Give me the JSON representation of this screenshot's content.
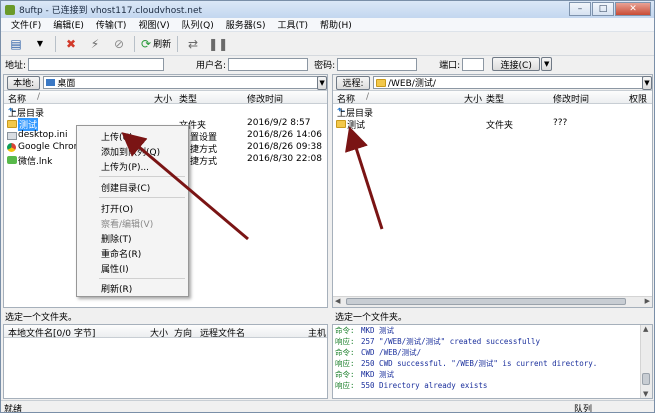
{
  "window": {
    "title": "8uftp - 已连接到 vhost117.cloudvhost.net",
    "minimize_icon": "minimize-icon",
    "maximize_icon": "maximize-icon",
    "close_icon": "close-icon"
  },
  "menu": [
    "文件(F)",
    "编辑(E)",
    "传输(T)",
    "视图(V)",
    "队列(Q)",
    "服务器(S)",
    "工具(T)",
    "帮助(H)"
  ],
  "toolbar": {
    "refresh_label": "刷新"
  },
  "address": {
    "address_label": "地址:",
    "user_label": "用户名:",
    "password_label": "密码:",
    "port_label": "端口:",
    "connect_label": "连接(C)"
  },
  "local": {
    "location_label": "本地:",
    "path": "桌面",
    "columns": [
      "名称",
      "大小",
      "类型",
      "修改时间"
    ],
    "up_label": "上层目录",
    "files": [
      {
        "name": "测试",
        "size": "",
        "type": "文件夹",
        "modified": "2016/9/2 8:57",
        "selected": true
      },
      {
        "name": "desktop.ini",
        "size": "",
        "type": "置设置",
        "modified": "2016/8/26 14:06"
      },
      {
        "name": "Google Chrom",
        "size": "",
        "type": "捷方式",
        "modified": "2016/8/26 09:38"
      },
      {
        "name": "微信.lnk",
        "size": "",
        "type": "捷方式",
        "modified": "2016/8/30 22:08"
      }
    ],
    "status": "选定一个文件夹。"
  },
  "remote": {
    "location_label": "远程:",
    "path": "/WEB/测试/",
    "columns": [
      "名称",
      "大小",
      "类型",
      "修改时间",
      "权限"
    ],
    "up_label": "上层目录",
    "files": [
      {
        "name": "测试",
        "size": "",
        "type": "文件夹",
        "modified": "???"
      }
    ],
    "status": "选定一个文件夹。"
  },
  "queue": {
    "columns": [
      "本地文件名[0/0 字节]",
      "大小",
      "方向",
      "远程文件名",
      "主机"
    ]
  },
  "log": [
    {
      "type": "命令:",
      "text": "MKD 测试"
    },
    {
      "type": "响应:",
      "text": "257 \"/WEB/测试/测试\" created successfully"
    },
    {
      "type": "命令:",
      "text": "CWD /WEB/测试/"
    },
    {
      "type": "响应:",
      "text": "250 CWD successful. \"/WEB/测试\" is current directory."
    },
    {
      "type": "命令:",
      "text": "MKD 测试"
    },
    {
      "type": "响应:",
      "text": "550 Directory already exists"
    }
  ],
  "context_menu": [
    {
      "label": "上传(U)",
      "enabled": true
    },
    {
      "label": "添加到队列(Q)",
      "enabled": true
    },
    {
      "label": "上传为(P)...",
      "enabled": true
    },
    {
      "label": "创建目录(C)",
      "enabled": true
    },
    {
      "label": "打开(O)",
      "enabled": true
    },
    {
      "label": "察看/编辑(V)",
      "enabled": false
    },
    {
      "label": "删除(T)",
      "enabled": true
    },
    {
      "label": "重命名(R)",
      "enabled": true
    },
    {
      "label": "属性(I)",
      "enabled": true
    },
    {
      "label": "刷新(R)",
      "enabled": true
    }
  ],
  "statusbar": {
    "left": "就绪",
    "right": "队列"
  },
  "colors": {
    "selection": "#3399ff",
    "arrow": "#7a1414",
    "log_type": "#1a7f2a",
    "log_text": "#1a2f9c"
  }
}
